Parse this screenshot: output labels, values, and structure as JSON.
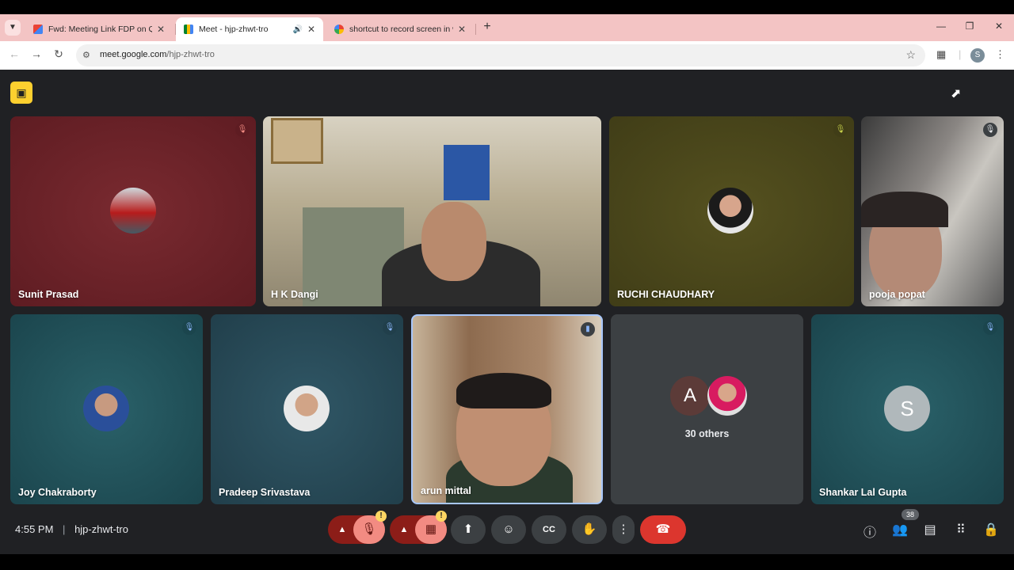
{
  "browser": {
    "tabs": [
      {
        "title": "Fwd: Meeting Link FDP on Qua",
        "icon": "gmail-icon",
        "active": false
      },
      {
        "title": "Meet - hjp-zhwt-tro",
        "icon": "meet-icon",
        "active": true
      },
      {
        "title": "shortcut to record screen in wi",
        "icon": "google-icon",
        "active": false
      }
    ],
    "url_domain": "meet.google.com",
    "url_path": "/hjp-zhwt-tro",
    "profile_initial": "S"
  },
  "meet": {
    "participants_row1": [
      {
        "name": "Sunit Prasad",
        "bg": "#6b2126",
        "avatar": true
      },
      {
        "name": "H K Dangi",
        "bg": "#b9a98b",
        "avatar": false
      },
      {
        "name": "RUCHI CHAUDHARY",
        "bg": "#4a4620",
        "avatar": true
      },
      {
        "name": "pooja popat",
        "bg": "#6d6a66",
        "avatar": false
      }
    ],
    "participants_row2": [
      {
        "name": "Joy Chakraborty",
        "bg": "#1f4f57",
        "avatar": true
      },
      {
        "name": "Pradeep Srivastava",
        "bg": "#274755",
        "avatar": true
      },
      {
        "name": "arun mittal",
        "bg": "#8a6a4f",
        "avatar": false
      },
      {
        "name": "30 others",
        "bg": "#3c4043",
        "avatar": true
      },
      {
        "name": "Shankar Lal Gupta",
        "bg": "#1f4f57",
        "avatar": true
      }
    ],
    "others_letter": "A",
    "shankar_letter": "S",
    "time": "4:55 PM",
    "separator": "|",
    "meeting_code": "hjp-zhwt-tro",
    "people_count": "38",
    "colors": {
      "danger": "#ea4335",
      "muted_bg": "#f28b82",
      "dark_ctl": "#3c4043",
      "accent": "#8ab4f8"
    }
  }
}
